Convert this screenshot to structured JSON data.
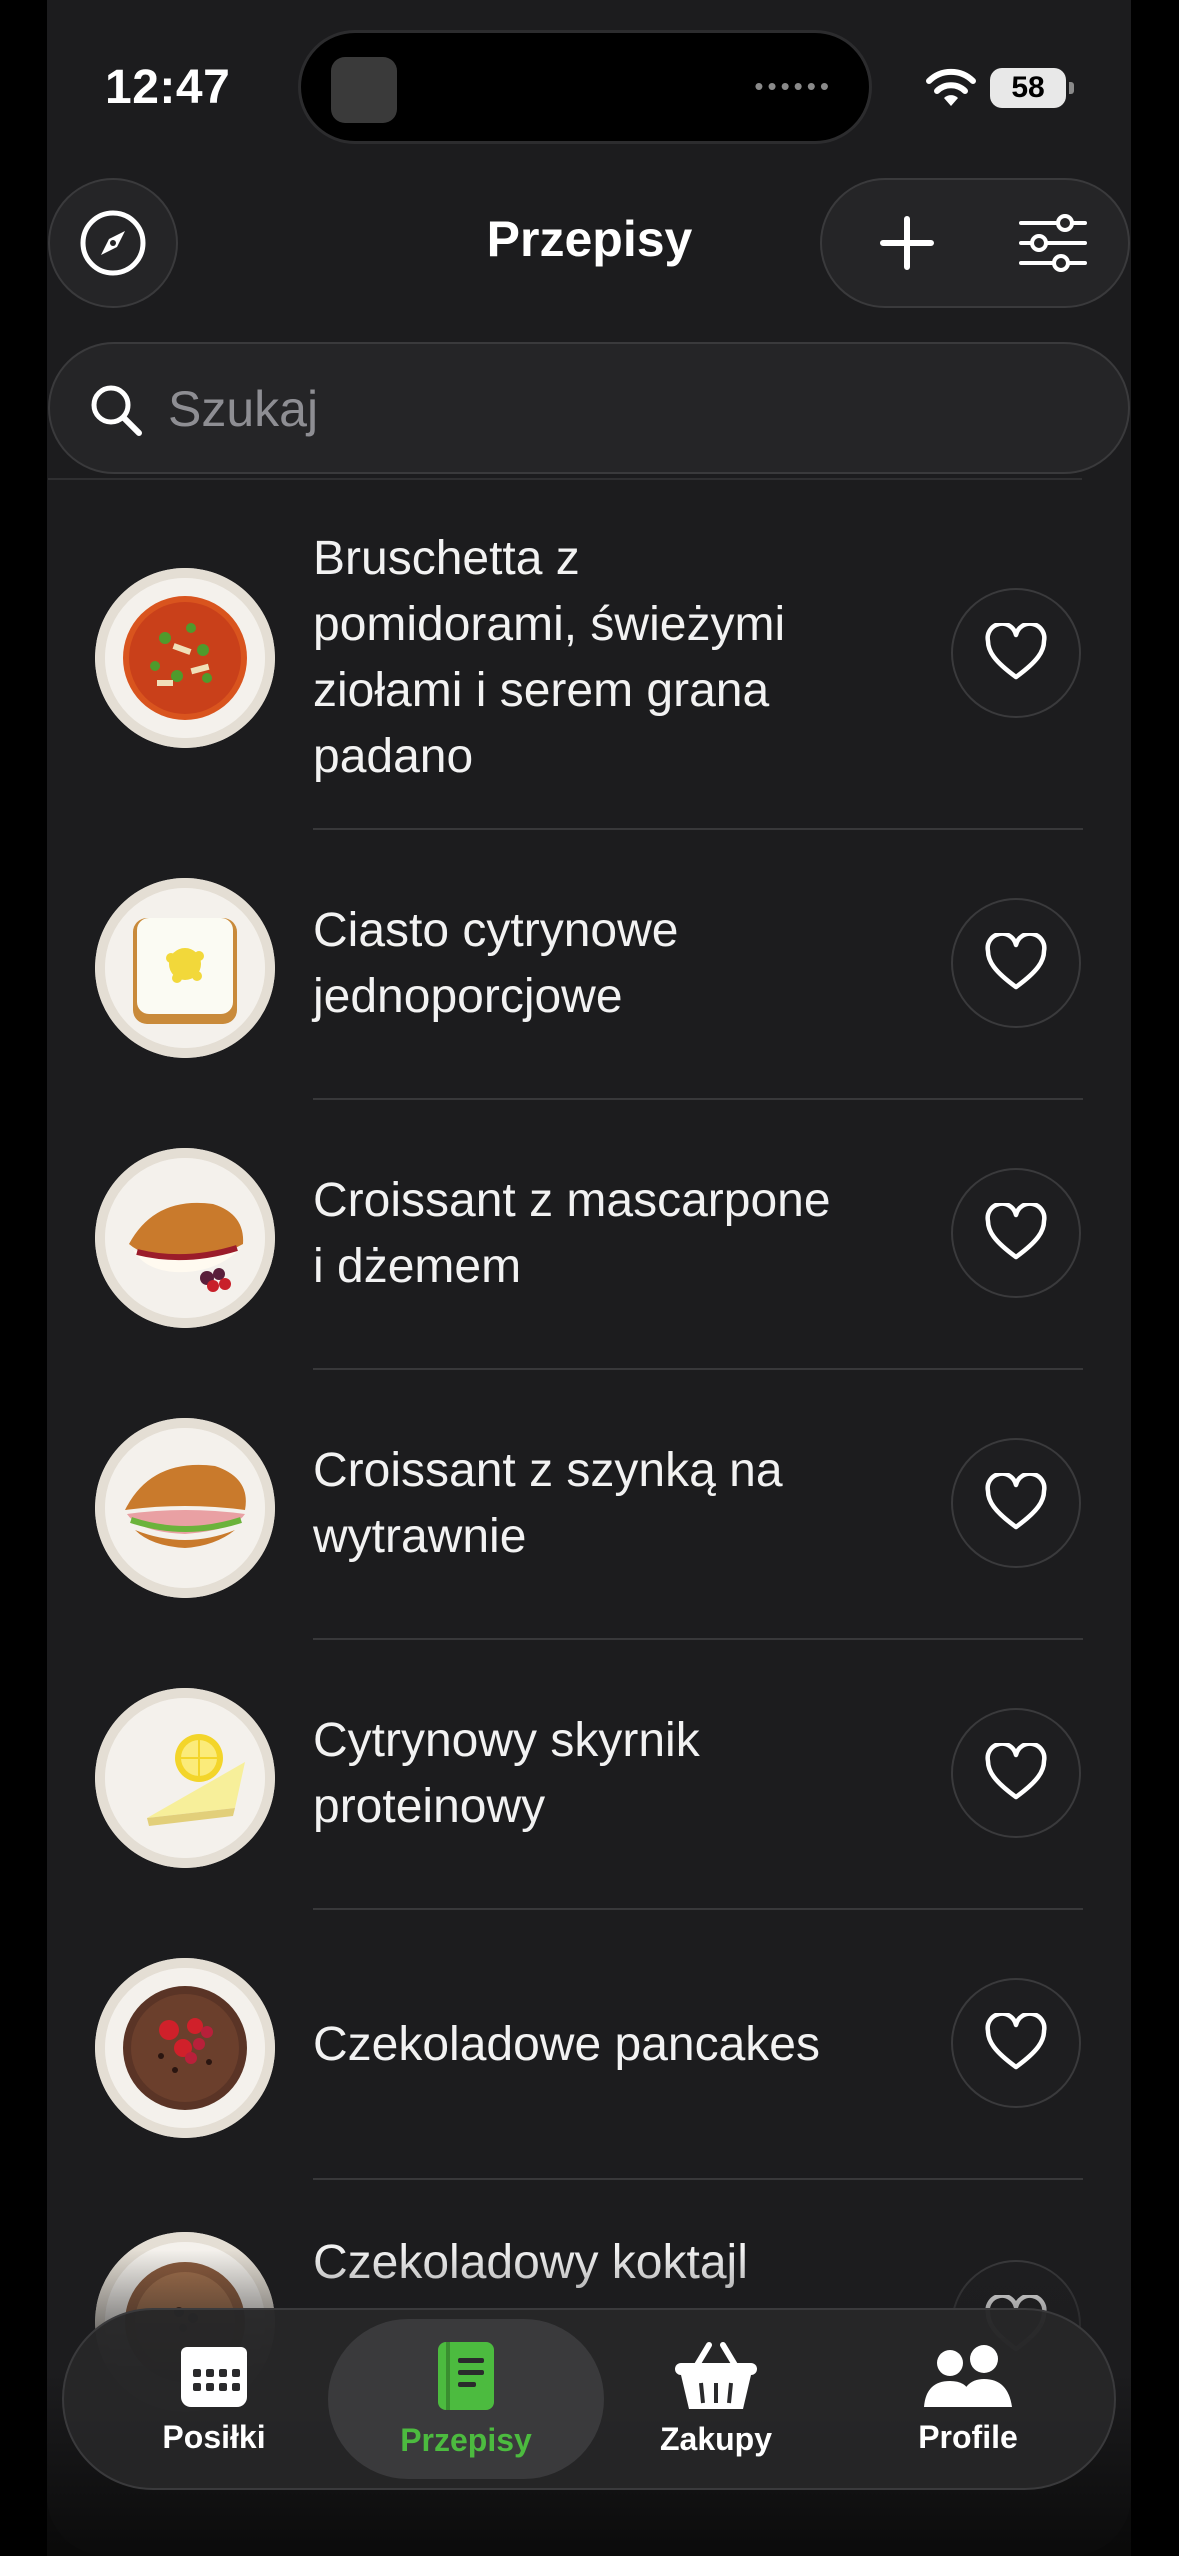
{
  "status_bar": {
    "time": "12:47",
    "battery": "58"
  },
  "header": {
    "title": "Przepisy"
  },
  "search": {
    "placeholder": "Szukaj"
  },
  "recipes": [
    {
      "title": "Bruschetta z pomidorami, świeżymi ziołami i serem grana padano",
      "image": "bruschetta"
    },
    {
      "title": "Ciasto cytrynowe jednoporcjowe",
      "image": "lemon-cake"
    },
    {
      "title": "Croissant z mascarpone i dżemem",
      "image": "croissant-jam"
    },
    {
      "title": "Croissant z szynką na wytrawnie",
      "image": "croissant-ham"
    },
    {
      "title": "Cytrynowy skyrnik proteinowy",
      "image": "lemon-cheesecake"
    },
    {
      "title": "Czekoladowe pancakes",
      "image": "chocolate-pancakes"
    },
    {
      "title": "Czekoladowy koktajl",
      "image": "chocolate-shake"
    }
  ],
  "tabbar": {
    "items": [
      {
        "label": "Posiłki",
        "icon": "calendar-icon"
      },
      {
        "label": "Przepisy",
        "icon": "book-icon",
        "active": true
      },
      {
        "label": "Zakupy",
        "icon": "basket-icon"
      },
      {
        "label": "Profile",
        "icon": "people-icon"
      }
    ]
  },
  "colors": {
    "accent": "#4cbb3f",
    "background": "#1c1c1e"
  }
}
